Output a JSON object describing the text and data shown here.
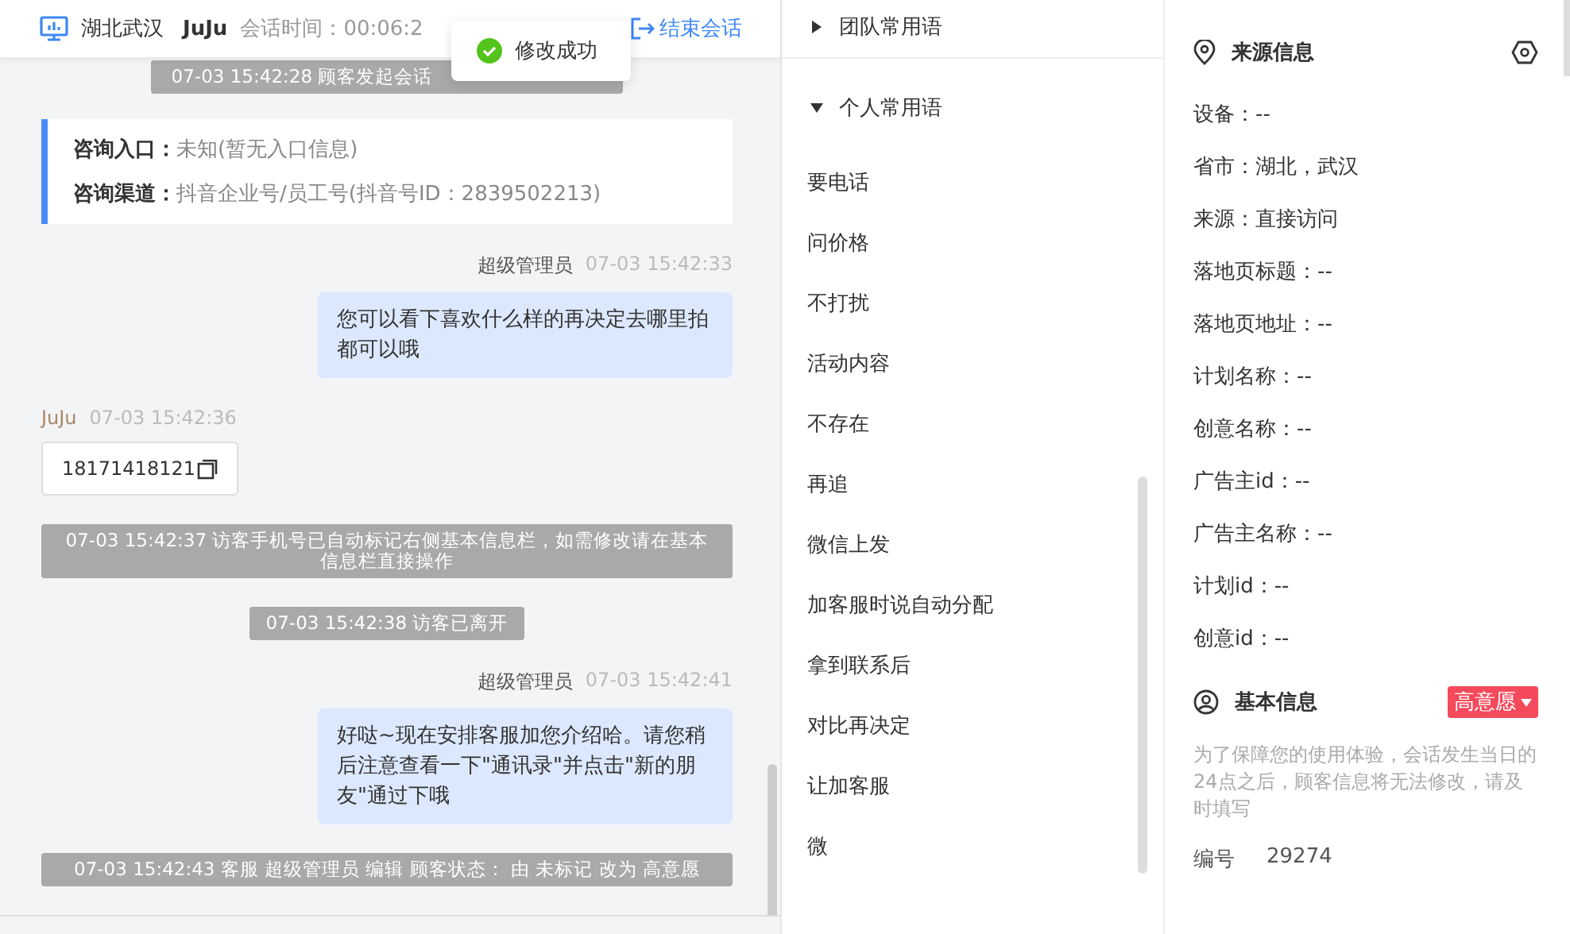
{
  "header": {
    "location": "湖北武汉",
    "visitor": "JuJu",
    "session_time": "会话时间：00:06:2",
    "end_button": "结束会话"
  },
  "toast": {
    "text": "修改成功"
  },
  "messages": [
    {
      "kind": "system",
      "text": "07-03 15:42:28 顾客发起会话"
    },
    {
      "kind": "info",
      "rows": [
        {
          "label": "咨询入口：",
          "value": "未知(暂无入口信息)"
        },
        {
          "label": "咨询渠道：",
          "value": "抖音企业号/员工号(抖音号ID：2839502213)"
        }
      ]
    },
    {
      "kind": "agent",
      "sender": "超级管理员",
      "time": "07-03 15:42:33",
      "text": "您可以看下喜欢什么样的再决定去哪里拍都可以哦"
    },
    {
      "kind": "visitor",
      "sender": "JuJu",
      "time": "07-03 15:42:36",
      "text": "18171418121"
    },
    {
      "kind": "system",
      "text": "07-03 15:42:37 访客手机号已自动标记右侧基本信息栏，如需修改请在基本信息栏直接操作"
    },
    {
      "kind": "system",
      "text": "07-03 15:42:38 访客已离开"
    },
    {
      "kind": "agent",
      "sender": "超级管理员",
      "time": "07-03 15:42:41",
      "text": "好哒~现在安排客服加您介绍哈。请您稍后注意查看一下\"通讯录\"并点击\"新的朋友\"通过下哦"
    },
    {
      "kind": "system",
      "text": "07-03 15:42:43 客服 超级管理员 编辑 顾客状态： 由 未标记 改为 高意愿"
    }
  ],
  "phrases": {
    "groups": [
      {
        "title": "团队常用语",
        "expanded": false
      },
      {
        "title": "个人常用语",
        "expanded": true,
        "items": [
          "要电话",
          "问价格",
          "不打扰",
          "活动内容",
          "不存在",
          "再追",
          "微信上发",
          "加客服时说自动分配",
          "拿到联系后",
          "对比再决定",
          "让加客服",
          "微"
        ]
      }
    ]
  },
  "source_info": {
    "title": "来源信息",
    "lines": [
      "设备：--",
      "省市：湖北，武汉",
      "来源：直接访问",
      "落地页标题：--",
      "落地页地址：--",
      "计划名称：--",
      "创意名称：--",
      "广告主id：--",
      "广告主名称：--",
      "计划id：--",
      "创意id：--"
    ]
  },
  "basic_info": {
    "title": "基本信息",
    "intent_tag": {
      "text": "高意愿",
      "color": "#f5495c"
    },
    "note": "为了保障您的使用体验，会话发生当日的24点之后，顾客信息将无法修改，请及时填写",
    "fields": [
      {
        "label": "编号",
        "value": "29274"
      }
    ]
  }
}
